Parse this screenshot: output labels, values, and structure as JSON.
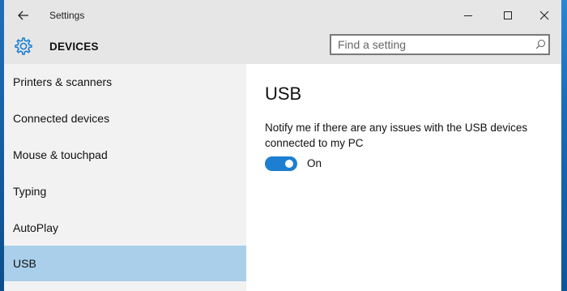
{
  "window": {
    "title": "Settings"
  },
  "header": {
    "section": "DEVICES"
  },
  "search": {
    "placeholder": "Find a setting"
  },
  "sidebar": {
    "items": [
      {
        "label": "Printers & scanners",
        "selected": false
      },
      {
        "label": "Connected devices",
        "selected": false
      },
      {
        "label": "Mouse & touchpad",
        "selected": false
      },
      {
        "label": "Typing",
        "selected": false
      },
      {
        "label": "AutoPlay",
        "selected": false
      },
      {
        "label": "USB",
        "selected": true
      }
    ]
  },
  "main": {
    "title": "USB",
    "description": "Notify me if there are any issues with the USB devices connected to my PC",
    "toggle": {
      "state_label": "On",
      "checked": true
    }
  },
  "icons": {
    "back": "back-arrow-icon",
    "minimize": "minimize-icon",
    "maximize": "maximize-icon",
    "close": "close-icon",
    "section": "gear-icon",
    "search": "search-icon"
  },
  "colors": {
    "accent": "#1c7fd1",
    "selected_item": "#a9cfea",
    "titlebar": "#e6e6e6",
    "sidebar": "#f2f2f2"
  }
}
